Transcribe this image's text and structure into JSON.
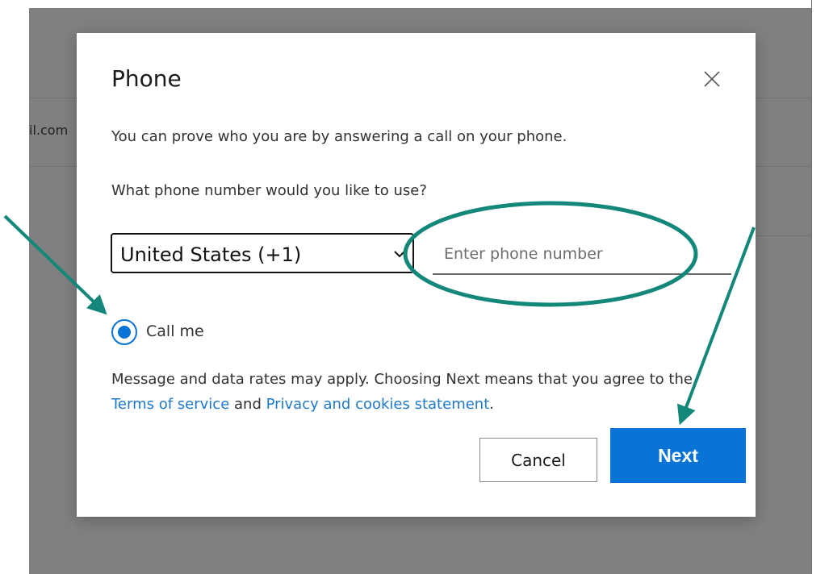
{
  "background": {
    "partial_email": "il.com"
  },
  "dialog": {
    "title": "Phone",
    "close_icon": "close-icon",
    "description": "You can prove who you are by answering a call on your phone.",
    "question": "What phone number would you like to use?",
    "country_select": {
      "selected": "United States (+1)",
      "icon": "chevron-down-icon"
    },
    "phone_input": {
      "value": "",
      "placeholder": "Enter phone number"
    },
    "radio": {
      "label": "Call me",
      "checked": true
    },
    "terms": {
      "part1": "Message and data rates may apply. Choosing Next means that you agree to the ",
      "terms_link": "Terms of service",
      "part2": " and ",
      "privacy_link": "Privacy and cookies statement",
      "part3": "."
    },
    "buttons": {
      "cancel": "Cancel",
      "next": "Next"
    }
  },
  "colors": {
    "accent": "#0a74d6",
    "link": "#1f78c8",
    "annotation": "#13877a",
    "backdrop": "#808080"
  }
}
